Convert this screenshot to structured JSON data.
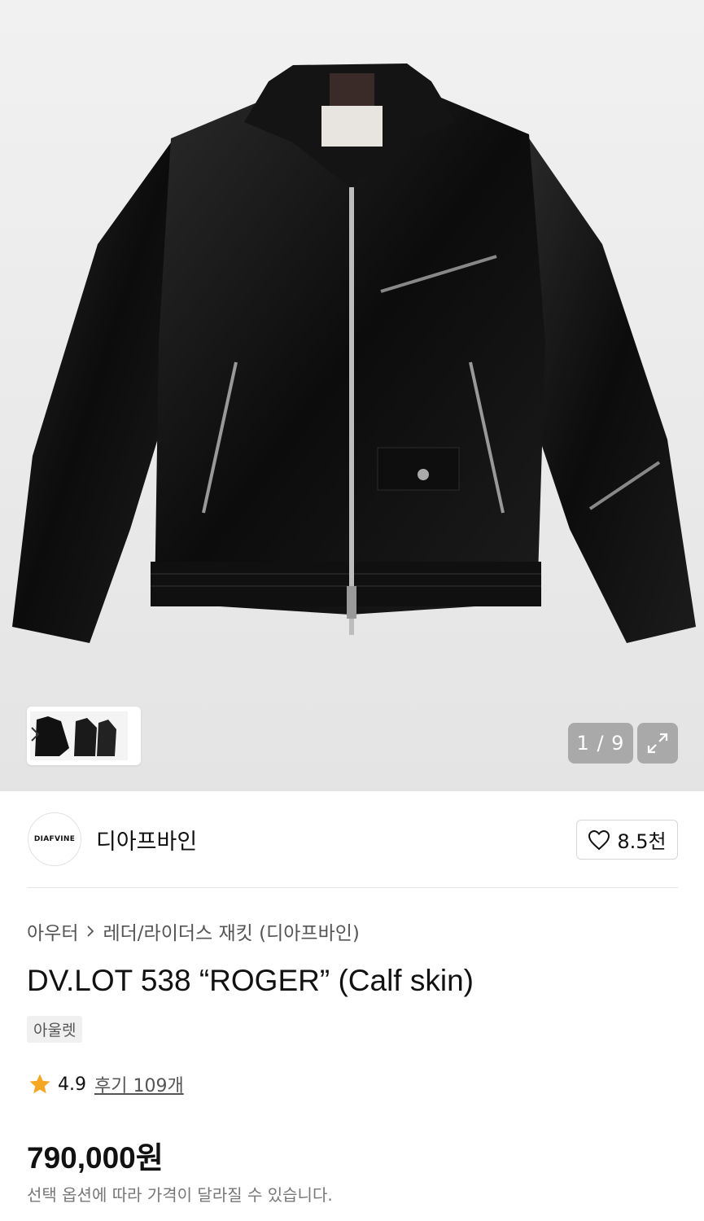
{
  "gallery": {
    "counter": "1 / 9",
    "thumbnail_icon": "thumbnail-strip",
    "expand_icon": "expand-icon"
  },
  "brand": {
    "logo_text": "DIAFVINE",
    "name": "디아프바인",
    "likes": "8.5천"
  },
  "breadcrumb": {
    "level1": "아우터",
    "level2": "레더/라이더스 재킷 (디아프바인)"
  },
  "product": {
    "title": "DV.LOT 538 “ROGER” (Calf skin)",
    "tag": "아울렛",
    "rating": "4.9",
    "review_label": "후기 109개",
    "price": "790,000원",
    "price_note": "선택 옵션에 따라 가격이 달라질 수 있습니다."
  },
  "colors": {
    "star": "#f5a623",
    "text": "#111111",
    "muted": "#777777"
  }
}
